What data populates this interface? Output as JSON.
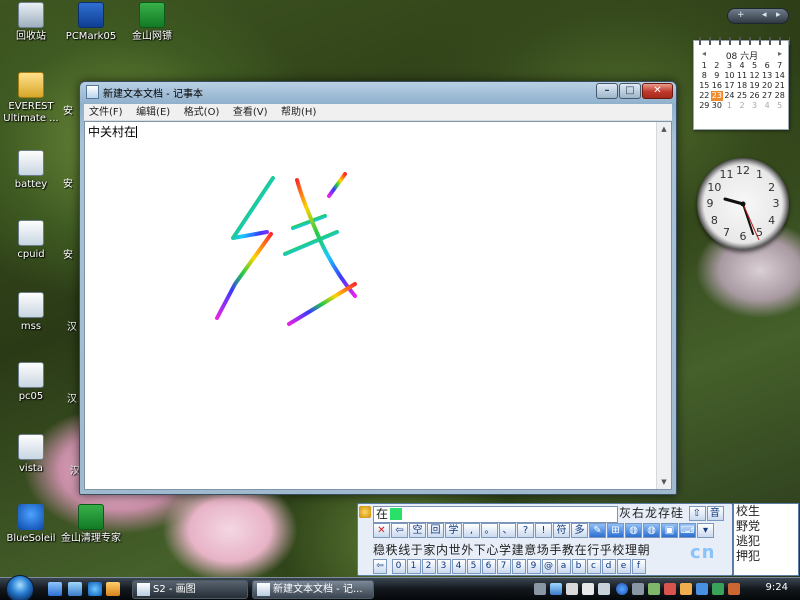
{
  "desktop": {
    "icons": [
      {
        "label": "回收站"
      },
      {
        "label": "PCMark05"
      },
      {
        "label": "金山网镖"
      },
      {
        "label": "EVEREST Ultimate ..."
      },
      {
        "label": "battey"
      },
      {
        "label": "cpuid"
      },
      {
        "label": "mss"
      },
      {
        "label": "pc05"
      },
      {
        "label": "vista"
      },
      {
        "label": "BlueSoleil"
      },
      {
        "label": "金山清理专家"
      }
    ],
    "partial_labels": [
      "安",
      "安",
      "安",
      "汉",
      "汉",
      "汉",
      "金"
    ]
  },
  "notepad": {
    "title": "新建文本文档 - 记事本",
    "controls": {
      "minimize": "–",
      "maximize": "□",
      "close": "✕"
    },
    "menu": [
      "文件(F)",
      "编辑(E)",
      "格式(O)",
      "查看(V)",
      "帮助(H)"
    ],
    "text": "中关村在"
  },
  "calendar": {
    "month": "08 六月",
    "days": [
      "1",
      "2",
      "3",
      "4",
      "5",
      "6",
      "7",
      "8",
      "9",
      "10",
      "11",
      "12",
      "13",
      "14",
      "15",
      "16",
      "17",
      "18",
      "19",
      "20",
      "21",
      "22",
      "23",
      "24",
      "25",
      "26",
      "27",
      "28",
      "29",
      "30",
      "1",
      "2",
      "3",
      "4",
      "5"
    ],
    "today": "23"
  },
  "clock": {
    "numbers": [
      "12",
      "1",
      "2",
      "3",
      "4",
      "5",
      "6",
      "7",
      "8",
      "9",
      "10",
      "11"
    ]
  },
  "ime": {
    "composition": "在",
    "candidates": "灰右龙存硅",
    "mode_buttons": [
      "⇧",
      "音"
    ],
    "toolbar": [
      "✕",
      "⇦",
      "空",
      "回",
      "学",
      ",",
      "。",
      "、",
      "?",
      "!",
      "符",
      "多"
    ],
    "words": "稳秩线于家内世外下心学建意场手教在行乎校理朝",
    "keys": [
      "0",
      "1",
      "2",
      "3",
      "4",
      "5",
      "6",
      "7",
      "8",
      "9",
      "@",
      "a",
      "b",
      "c",
      "d",
      "e",
      "f"
    ]
  },
  "side_list": [
    "校生",
    "野党",
    "逃犯",
    "押犯"
  ],
  "taskbar": {
    "tasks": [
      "S2 - 画图",
      "新建文本文档 - 记..."
    ],
    "time": "9:24"
  },
  "watermark": "cn",
  "colors": {
    "accent": "#f08c2c",
    "close": "#c0392b",
    "title_bar": "#b9d0e4"
  }
}
